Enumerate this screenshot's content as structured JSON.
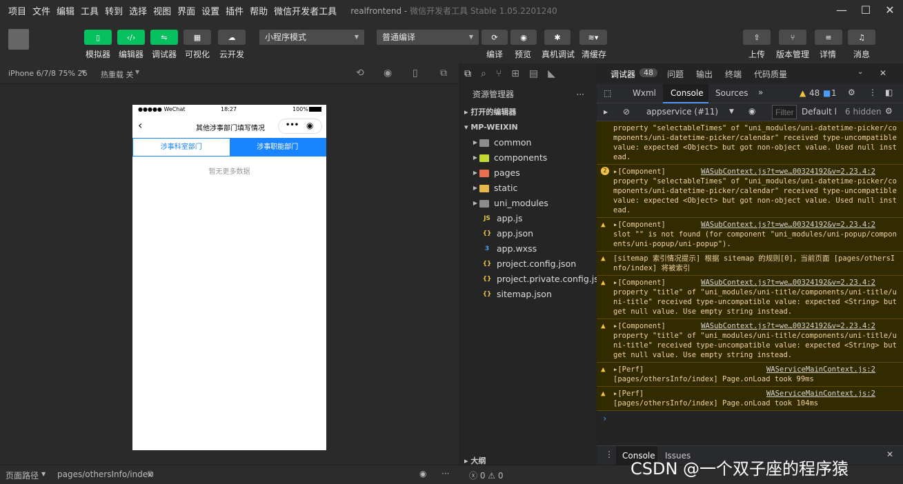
{
  "menu": [
    "项目",
    "文件",
    "编辑",
    "工具",
    "转到",
    "选择",
    "视图",
    "界面",
    "设置",
    "插件",
    "帮助",
    "微信开发者工具"
  ],
  "app_title": {
    "project": "realfrontend",
    "tool": "微信开发者工具 Stable 1.05.2201240"
  },
  "toolbar": {
    "buttons": [
      "模拟器",
      "编辑器",
      "调试器",
      "可视化",
      "云开发"
    ],
    "mode_select": "小程序模式",
    "compile_select": "普通编译",
    "actions": [
      "编译",
      "预览",
      "真机调试",
      "清缓存"
    ],
    "right_actions": [
      "上传",
      "版本管理",
      "详情",
      "消息"
    ]
  },
  "simulator": {
    "device": "iPhone 6/7/8 75% 26",
    "hotreload": "热重载 关",
    "status_left": "●●●●● WeChat",
    "status_time": "18:27",
    "status_battery": "100%",
    "nav_title": "其他涉事部门填写情况",
    "tabs": [
      "涉事科室部门",
      "涉事职能部门"
    ],
    "empty_text": "暂无更多数据"
  },
  "explorer": {
    "title": "资源管理器",
    "open_editors": "打开的编辑器",
    "root": "MP-WEIXIN",
    "folders": [
      {
        "name": "common",
        "color": "#8c8c8c"
      },
      {
        "name": "components",
        "color": "#c3d932"
      },
      {
        "name": "pages",
        "color": "#e8704f"
      },
      {
        "name": "static",
        "color": "#e6b84c"
      },
      {
        "name": "uni_modules",
        "color": "#8c8c8c"
      }
    ],
    "files": [
      {
        "name": "app.js",
        "icon": "JS",
        "color": "#e6c34c"
      },
      {
        "name": "app.json",
        "icon": "{}",
        "color": "#e6c34c"
      },
      {
        "name": "app.wxss",
        "icon": "3",
        "color": "#4aa4f2"
      },
      {
        "name": "project.config.json",
        "icon": "{}",
        "color": "#e6c34c"
      },
      {
        "name": "project.private.config.js...",
        "icon": "{}",
        "color": "#e6c34c"
      },
      {
        "name": "sitemap.json",
        "icon": "{}",
        "color": "#e6c34c"
      }
    ],
    "outline": "大纲",
    "problems": "ⓧ 0 ⚠ 0"
  },
  "devtools": {
    "tabs": [
      "调试器",
      "问题",
      "输出",
      "终端",
      "代码质量"
    ],
    "debugger_count": "48",
    "panels": [
      "Wxml",
      "Console",
      "Sources"
    ],
    "warn_count": "48",
    "info_count": "1",
    "context": "appservice (#11)",
    "filter_placeholder": "Filter",
    "levels": "Default l",
    "hidden": "6 hidden",
    "messages": [
      {
        "icon": "",
        "text": "property \"selectableTimes\" of \"uni_modules/uni-datetime-picker/components/uni-datetime-picker/calendar\" received type-uncompatible value: expected <Object> but got non-object value. Used null instead.",
        "src": ""
      },
      {
        "icon": "2",
        "text": "▸[Component]    \nproperty \"selectableTimes\" of \"uni_modules/uni-datetime-picker/components/uni-datetime-picker/calendar\" received type-uncompatible value: expected <Object> but got non-object value. Used null instead.",
        "src": "WASubContext.js?t=we…00324192&v=2.23.4:2"
      },
      {
        "icon": "⚠",
        "text": "▸[Component]    \nslot \"\" is not found (for component \"uni_modules/uni-popup/components/uni-popup/uni-popup\").",
        "src": "WASubContext.js?t=we…00324192&v=2.23.4:2"
      },
      {
        "icon": "⚠",
        "text": "[sitemap 索引情况提示] 根据 sitemap 的规则[0]，当前页面 [pages/othersInfo/index] 将被索引",
        "src": ""
      },
      {
        "icon": "⚠",
        "text": "▸[Component]    \nproperty \"title\" of \"uni_modules/uni-title/components/uni-title/uni-title\" received type-uncompatible value: expected <String> but get null value. Use empty string instead.",
        "src": "WASubContext.js?t=we…00324192&v=2.23.4:2"
      },
      {
        "icon": "⚠",
        "text": "▸[Component]    \nproperty \"title\" of \"uni_modules/uni-title/components/uni-title/uni-title\" received type-uncompatible value: expected <String> but get null value. Use empty string instead.",
        "src": "WASubContext.js?t=we…00324192&v=2.23.4:2"
      },
      {
        "icon": "⚠",
        "text": "▸[Perf]\n[pages/othersInfo/index] Page.onLoad took 99ms",
        "src": "WAServiceMainContext.js:2"
      },
      {
        "icon": "⚠",
        "text": "▸[Perf]\n[pages/othersInfo/index] Page.onLoad took 104ms",
        "src": "WAServiceMainContext.js:2"
      }
    ],
    "drawer_tabs": [
      "Console",
      "Issues"
    ]
  },
  "statusbar": {
    "path_label": "页面路径",
    "path": "pages/othersInfo/index"
  },
  "watermark": "CSDN @一个双子座的程序猿"
}
